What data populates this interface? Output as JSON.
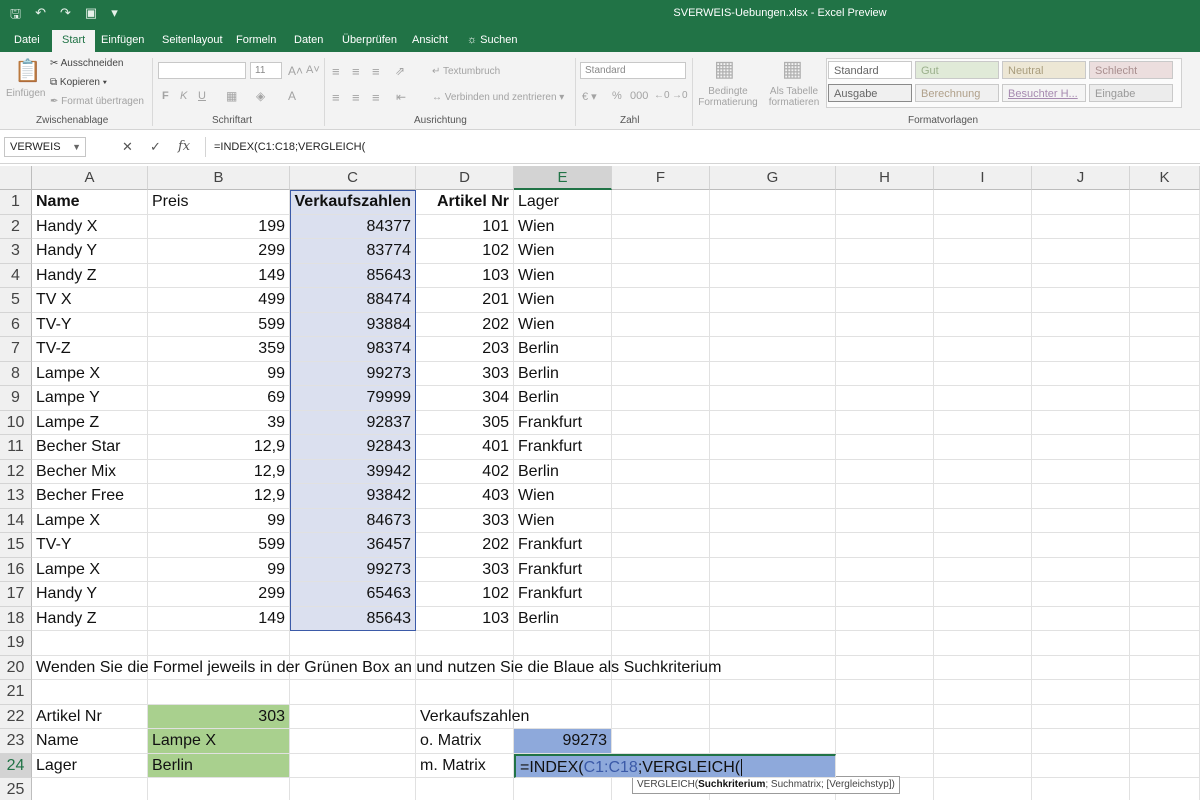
{
  "window": {
    "title": "SVERWEIS-Uebungen.xlsx  -  Excel Preview"
  },
  "tabs": [
    "Datei",
    "Start",
    "Einfügen",
    "Seitenlayout",
    "Formeln",
    "Daten",
    "Überprüfen",
    "Ansicht",
    "Suchen"
  ],
  "ribbon": {
    "clipboard": {
      "paste": "Einfügen",
      "cut": "Ausschneiden",
      "copy": "Kopieren",
      "format_painter": "Format übertragen",
      "label": "Zwischenablage"
    },
    "font": {
      "size": "11",
      "bold": "F",
      "italic": "K",
      "underline": "U",
      "label": "Schriftart"
    },
    "alignment": {
      "wrap": "Textumbruch",
      "merge": "Verbinden und zentrieren",
      "label": "Ausrichtung"
    },
    "number": {
      "format": "Standard",
      "label": "Zahl"
    },
    "styles": {
      "conditional": "Bedingte Formatierung",
      "as_table": "Als Tabelle formatieren",
      "cells": [
        "Standard",
        "Gut",
        "Neutral",
        "Schlecht",
        "Ausgabe",
        "Berechnung",
        "Besuchter H...",
        "Eingabe"
      ],
      "label": "Formatvorlagen"
    }
  },
  "formula_bar": {
    "name_box": "VERWEIS",
    "formula": "=INDEX(C1:C18;VERGLEICH("
  },
  "columns": [
    "A",
    "B",
    "C",
    "D",
    "E",
    "F",
    "G",
    "H",
    "I",
    "J",
    "K"
  ],
  "rows": [
    "1",
    "2",
    "3",
    "4",
    "5",
    "6",
    "7",
    "8",
    "9",
    "10",
    "11",
    "12",
    "13",
    "14",
    "15",
    "16",
    "17",
    "18",
    "19",
    "20",
    "21",
    "22",
    "23",
    "24",
    "25"
  ],
  "table": {
    "headers": {
      "name": "Name",
      "price": "Preis",
      "sales": "Verkaufszahlen",
      "article": "Artikel Nr",
      "warehouse": "Lager"
    },
    "rows": [
      [
        "Handy X",
        "199",
        "84377",
        "101",
        "Wien"
      ],
      [
        "Handy Y",
        "299",
        "83774",
        "102",
        "Wien"
      ],
      [
        "Handy Z",
        "149",
        "85643",
        "103",
        "Wien"
      ],
      [
        "TV X",
        "499",
        "88474",
        "201",
        "Wien"
      ],
      [
        "TV-Y",
        "599",
        "93884",
        "202",
        "Wien"
      ],
      [
        "TV-Z",
        "359",
        "98374",
        "203",
        "Berlin"
      ],
      [
        "Lampe X",
        "99",
        "99273",
        "303",
        "Berlin"
      ],
      [
        "Lampe Y",
        "69",
        "79999",
        "304",
        "Berlin"
      ],
      [
        "Lampe Z",
        "39",
        "92837",
        "305",
        "Frankfurt"
      ],
      [
        "Becher Star",
        "12,9",
        "92843",
        "401",
        "Frankfurt"
      ],
      [
        "Becher Mix",
        "12,9",
        "39942",
        "402",
        "Berlin"
      ],
      [
        "Becher Free",
        "12,9",
        "93842",
        "403",
        "Wien"
      ],
      [
        "Lampe X",
        "99",
        "84673",
        "303",
        "Wien"
      ],
      [
        "TV-Y",
        "599",
        "36457",
        "202",
        "Frankfurt"
      ],
      [
        "Lampe X",
        "99",
        "99273",
        "303",
        "Frankfurt"
      ],
      [
        "Handy Y",
        "299",
        "65463",
        "102",
        "Frankfurt"
      ],
      [
        "Handy Z",
        "149",
        "85643",
        "103",
        "Berlin"
      ]
    ]
  },
  "instruction": "Wenden Sie die Formel jeweils in der Grünen Box an und nutzen Sie die Blaue als Suchkriterium",
  "lookup": {
    "article_label": "Artikel Nr",
    "article_value": "303",
    "name_label": "Name",
    "name_value": "Lampe X",
    "warehouse_label": "Lager",
    "warehouse_value": "Berlin",
    "sales_label": "Verkaufszahlen",
    "o_matrix_label": "o. Matrix",
    "o_matrix_value": "99273",
    "m_matrix_label": "m. Matrix",
    "m_matrix_formula_a": "=INDEX(",
    "m_matrix_formula_b": "C1:C18",
    "m_matrix_formula_c": ";VERGLEICH("
  },
  "tooltip": {
    "func": "VERGLEICH(",
    "arg1": "Suchkriterium",
    "rest": "; Suchmatrix; [Vergleichstyp])"
  },
  "colors": {
    "excel_green": "#217346",
    "green_box": "#a9d08e",
    "blue_box": "#8ea9db",
    "range_blue": "#dbe0ef"
  }
}
